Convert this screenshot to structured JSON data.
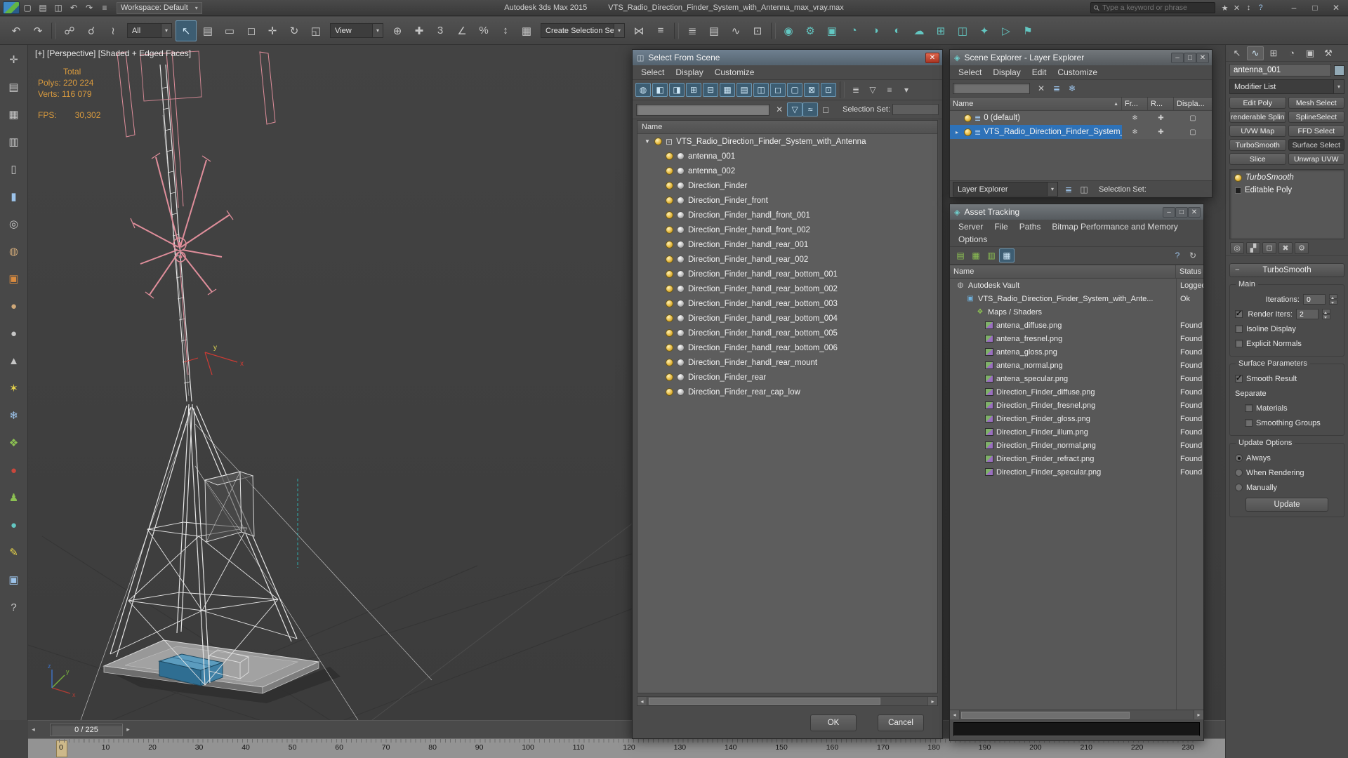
{
  "ui": {
    "caret": "▾"
  },
  "titlebar": {
    "quick_icons": [
      {
        "n": "new-scene",
        "g": "▢",
        "cls": ""
      },
      {
        "n": "open-file",
        "g": "▤",
        "cls": ""
      },
      {
        "n": "save-file",
        "g": "◫",
        "cls": ""
      },
      {
        "n": "undo",
        "g": "↶",
        "cls": ""
      },
      {
        "n": "redo",
        "g": "↷",
        "cls": ""
      },
      {
        "n": "project-folder",
        "g": "≡",
        "cls": ""
      }
    ],
    "workspace": "Workspace: Default",
    "app_title": "Autodesk 3ds Max  2015",
    "doc_title": "VTS_Radio_Direction_Finder_System_with_Antenna_max_vray.max",
    "search_placeholder": "Type a keyword or phrase",
    "search_magnifier": "⚲",
    "search_icons": [
      {
        "n": "favorites",
        "g": "★",
        "cls": ""
      },
      {
        "n": "clear-search",
        "g": "✕",
        "cls": ""
      },
      {
        "n": "search-history",
        "g": "↕",
        "cls": ""
      },
      {
        "n": "help",
        "g": "?",
        "cls": "c-blue"
      }
    ],
    "window_buttons": [
      {
        "n": "minimize",
        "g": "–"
      },
      {
        "n": "maximize",
        "g": "□"
      },
      {
        "n": "close",
        "g": "✕"
      }
    ]
  },
  "toolbar": {
    "dd_all": "All",
    "dd_view": "View",
    "dd_create": "Create Selection Se",
    "icons_a": [
      {
        "n": "undo",
        "g": "↶",
        "cls": ""
      },
      {
        "n": "redo",
        "g": "↷",
        "cls": ""
      },
      {
        "n": "sep",
        "g": "",
        "cls": "sep"
      },
      {
        "n": "select-and-link",
        "g": "☍",
        "cls": ""
      },
      {
        "n": "unlink-selection",
        "g": "☌",
        "cls": ""
      },
      {
        "n": "bind-to-space-warp",
        "g": "≀",
        "cls": ""
      }
    ],
    "icons_b": [
      {
        "n": "select-object",
        "g": "↖",
        "cls": "on"
      },
      {
        "n": "select-by-name",
        "g": "▤",
        "cls": ""
      },
      {
        "n": "rectangular-selection-region",
        "g": "▭",
        "cls": ""
      },
      {
        "n": "window-crossing",
        "g": "◻",
        "cls": ""
      }
    ],
    "icons_c": [
      {
        "n": "select-and-move",
        "g": "✛",
        "cls": ""
      },
      {
        "n": "select-and-rotate",
        "g": "↻",
        "cls": ""
      },
      {
        "n": "select-and-scale",
        "g": "◱",
        "cls": ""
      }
    ],
    "icons_d": [
      {
        "n": "use-center",
        "g": "⊕",
        "cls": ""
      },
      {
        "n": "select-and-manipulate",
        "g": "✚",
        "cls": ""
      }
    ],
    "icons_e": [
      {
        "n": "snaps-toggle",
        "g": "3",
        "cls": ""
      },
      {
        "n": "angle-snap",
        "g": "∠",
        "cls": ""
      },
      {
        "n": "percent-snap",
        "g": "%",
        "cls": ""
      },
      {
        "n": "spinner-snap",
        "g": "↕",
        "cls": ""
      }
    ],
    "icons_f": [
      {
        "n": "edit-named-selection-sets",
        "g": "▦",
        "cls": ""
      }
    ],
    "icons_g": [
      {
        "n": "mirror",
        "g": "⋈",
        "cls": ""
      },
      {
        "n": "align",
        "g": "≡",
        "cls": ""
      },
      {
        "n": "sep",
        "g": "",
        "cls": "sep"
      },
      {
        "n": "layer-manager",
        "g": "≣",
        "cls": ""
      },
      {
        "n": "graphite-ribbon",
        "g": "▤",
        "cls": ""
      },
      {
        "n": "curve-editor",
        "g": "∿",
        "cls": ""
      },
      {
        "n": "schematic-view",
        "g": "⊡",
        "cls": ""
      },
      {
        "n": "sep2",
        "g": "",
        "cls": "sep"
      }
    ],
    "icons_h": [
      {
        "n": "material-editor",
        "g": "◉",
        "cls": "c-teal"
      },
      {
        "n": "render-setup",
        "g": "⚙",
        "cls": "c-teal"
      },
      {
        "n": "rendered-frame-window",
        "g": "▣",
        "cls": "c-teal"
      },
      {
        "n": "render-production",
        "g": "◔",
        "cls": "c-teal"
      },
      {
        "n": "render-iterative",
        "g": "◑",
        "cls": "c-teal"
      },
      {
        "n": "activeshade",
        "g": "◐",
        "cls": "c-teal"
      },
      {
        "n": "a360-render",
        "g": "☁",
        "cls": "c-teal"
      },
      {
        "n": "render-elements",
        "g": "⊞",
        "cls": "c-teal"
      },
      {
        "n": "environment",
        "g": "◫",
        "cls": "c-teal"
      },
      {
        "n": "effects",
        "g": "✦",
        "cls": "c-teal"
      },
      {
        "n": "ram-player",
        "g": "▷",
        "cls": "c-teal"
      },
      {
        "n": "preview-grab",
        "g": "⚑",
        "cls": "c-teal"
      }
    ]
  },
  "left_toolbar": {
    "icons": [
      {
        "n": "pan-tool",
        "g": "✛",
        "cls": ""
      },
      {
        "n": "grid-tool",
        "g": "▤",
        "cls": ""
      },
      {
        "n": "lattice-tool",
        "g": "▦",
        "cls": ""
      },
      {
        "n": "film-tool",
        "g": "▥",
        "cls": ""
      },
      {
        "n": "cylinder-tool",
        "g": "▯",
        "cls": ""
      },
      {
        "n": "spray-tool",
        "g": "▮",
        "cls": "c-blue"
      },
      {
        "n": "wheel-tool",
        "g": "◎",
        "cls": ""
      },
      {
        "n": "teapot-tool",
        "g": "◍",
        "cls": "c-tan"
      },
      {
        "n": "box-tool",
        "g": "▣",
        "cls": "c-orange"
      },
      {
        "n": "sphere-tool",
        "g": "●",
        "cls": "c-tan"
      },
      {
        "n": "geosphere-tool",
        "g": "●",
        "cls": ""
      },
      {
        "n": "cone-tool",
        "g": "▲",
        "cls": ""
      },
      {
        "n": "star-tool",
        "g": "✶",
        "cls": "c-yellow"
      },
      {
        "n": "snowflake-tool",
        "g": "❄",
        "cls": "c-blue"
      },
      {
        "n": "foliage-tool",
        "g": "❖",
        "cls": "c-green"
      },
      {
        "n": "red-ball-tool",
        "g": "●",
        "cls": "c-red"
      },
      {
        "n": "figure-tool",
        "g": "♟",
        "cls": "c-green"
      },
      {
        "n": "teal-ball-tool",
        "g": "●",
        "cls": "c-teal"
      },
      {
        "n": "pencil-tool",
        "g": "✎",
        "cls": "c-yellow"
      },
      {
        "n": "blue-box-tool",
        "g": "▣",
        "cls": "c-blue"
      },
      {
        "n": "help-tool",
        "g": "?",
        "cls": ""
      }
    ]
  },
  "viewport": {
    "label": "[+] [Perspective] [Shaded + Edged Faces]",
    "stats": {
      "total_label": "Total",
      "polys": "Polys: 220 224",
      "verts": "Verts: 116 079",
      "fps_label": "FPS:",
      "fps_value": "30,302"
    },
    "axis": {
      "x": "x",
      "y": "y",
      "z": "z"
    }
  },
  "select_from_scene": {
    "title": "Select From Scene",
    "title_icon": "◫",
    "close_glyph": "✕",
    "menus": [
      "Select",
      "Display",
      "Customize"
    ],
    "toolbar_icons": [
      {
        "n": "display-none",
        "g": "◍",
        "cls": "on"
      },
      {
        "n": "display-geometry",
        "g": "◧",
        "cls": "on"
      },
      {
        "n": "display-shapes",
        "g": "◨",
        "cls": "on"
      },
      {
        "n": "display-lights",
        "g": "⊞",
        "cls": "on"
      },
      {
        "n": "display-cameras",
        "g": "⊟",
        "cls": "on"
      },
      {
        "n": "display-helpers",
        "g": "▦",
        "cls": "on"
      },
      {
        "n": "display-space-warps",
        "g": "▤",
        "cls": "on"
      },
      {
        "n": "display-groups",
        "g": "◫",
        "cls": "on"
      },
      {
        "n": "display-xrefs",
        "g": "◻",
        "cls": "on"
      },
      {
        "n": "display-bones",
        "g": "▢",
        "cls": "on"
      },
      {
        "n": "display-containers",
        "g": "⊠",
        "cls": "on"
      },
      {
        "n": "display-frozen",
        "g": "⊡",
        "cls": "on"
      },
      {
        "n": "sep",
        "g": "",
        "cls": "sep"
      },
      {
        "n": "sort",
        "g": "≣",
        "cls": ""
      },
      {
        "n": "filter",
        "g": "▽",
        "cls": ""
      },
      {
        "n": "column-chooser",
        "g": "≡",
        "cls": ""
      },
      {
        "n": "options",
        "g": "▾",
        "cls": ""
      }
    ],
    "filter_icons": [
      {
        "n": "clear-filter",
        "g": "✕",
        "cls": ""
      },
      {
        "n": "filter-combinations",
        "g": "▽",
        "cls": "onb"
      },
      {
        "n": "advanced-filter",
        "g": "≈",
        "cls": "onb"
      },
      {
        "n": "pick-filter",
        "g": "◻",
        "cls": ""
      }
    ],
    "selection_set_label": "Selection Set:",
    "name_header": "Name",
    "root_arrow": "▼",
    "root_icon": "⊡",
    "root": "VTS_Radio_Direction_Finder_System_with_Antenna",
    "items": [
      "antenna_001",
      "antenna_002",
      "Direction_Finder",
      "Direction_Finder_front",
      "Direction_Finder_handl_front_001",
      "Direction_Finder_handl_front_002",
      "Direction_Finder_handl_rear_001",
      "Direction_Finder_handl_rear_002",
      "Direction_Finder_handl_rear_bottom_001",
      "Direction_Finder_handl_rear_bottom_002",
      "Direction_Finder_handl_rear_bottom_003",
      "Direction_Finder_handl_rear_bottom_004",
      "Direction_Finder_handl_rear_bottom_005",
      "Direction_Finder_handl_rear_bottom_006",
      "Direction_Finder_handl_rear_mount",
      "Direction_Finder_rear",
      "Direction_Finder_rear_cap_low"
    ],
    "ok": "OK",
    "cancel": "Cancel"
  },
  "scene_explorer": {
    "title": "Scene Explorer - Layer Explorer",
    "title_icon": "◈",
    "menus": [
      "Select",
      "Display",
      "Edit",
      "Customize"
    ],
    "toolbar_icons": [
      {
        "n": "clear-search",
        "g": "✕",
        "cls": ""
      },
      {
        "n": "layer-list",
        "g": "≣",
        "cls": "c-blue"
      },
      {
        "n": "frozen-filter",
        "g": "❄",
        "cls": "c-blue"
      }
    ],
    "columns": [
      {
        "label": "Name",
        "arrow": "▲",
        "cls": "cname"
      },
      {
        "label": "Fr...",
        "arrow": "",
        "cls": "csm"
      },
      {
        "label": "R...",
        "arrow": "",
        "cls": "csm"
      },
      {
        "label": "Displa...",
        "arrow": "",
        "cls": "clg"
      }
    ],
    "layer_icon": "≣",
    "row_icons": [
      "❄",
      "✚",
      "▢"
    ],
    "rows": [
      {
        "arrow": "",
        "label": "0 (default)",
        "cls": ""
      },
      {
        "arrow": "▸",
        "label": "VTS_Radio_Direction_Finder_System_...",
        "cls": "sel"
      }
    ],
    "bottom_dropdown": "Layer Explorer",
    "bottom_icons": [
      {
        "n": "new-layer",
        "g": "≣",
        "cls": "c-blue"
      },
      {
        "n": "pick-layer",
        "g": "◫",
        "cls": ""
      }
    ],
    "selection_set_label": "Selection Set:"
  },
  "asset_tracking": {
    "title": "Asset Tracking",
    "title_icon": "◈",
    "menus": [
      "Server",
      "File",
      "Paths",
      "Bitmap Performance and Memory",
      "Options"
    ],
    "toolbar_left": [
      {
        "n": "status-view",
        "g": "▤",
        "cls": "c-green"
      },
      {
        "n": "detail-view",
        "g": "▦",
        "cls": "c-green"
      },
      {
        "n": "list-view",
        "g": "▥",
        "cls": "c-green"
      },
      {
        "n": "table-view",
        "g": "▦",
        "cls": "on"
      }
    ],
    "toolbar_right": [
      {
        "n": "help",
        "g": "?",
        "cls": "c-blue"
      },
      {
        "n": "refresh",
        "g": "↻",
        "cls": ""
      }
    ],
    "name_header": "Name",
    "status_header": "Status",
    "rows": [
      {
        "name": "Autodesk Vault",
        "status": "Logged",
        "icon": "i-vault",
        "g": "◍",
        "ind": "ind1"
      },
      {
        "name": "VTS_Radio_Direction_Finder_System_with_Ante...",
        "status": "Ok",
        "icon": "i-scene",
        "g": "▣",
        "ind": "ind2"
      },
      {
        "name": "Maps / Shaders",
        "status": "",
        "icon": "i-maps",
        "g": "❖",
        "ind": "ind3"
      },
      {
        "name": "antena_diffuse.png",
        "status": "Found",
        "icon": "i-png",
        "g": "",
        "ind": "ind4"
      },
      {
        "name": "antena_fresnel.png",
        "status": "Found",
        "icon": "i-png",
        "g": "",
        "ind": "ind4"
      },
      {
        "name": "antena_gloss.png",
        "status": "Found",
        "icon": "i-png",
        "g": "",
        "ind": "ind4"
      },
      {
        "name": "antena_normal.png",
        "status": "Found",
        "icon": "i-png",
        "g": "",
        "ind": "ind4"
      },
      {
        "name": "antena_specular.png",
        "status": "Found",
        "icon": "i-png",
        "g": "",
        "ind": "ind4"
      },
      {
        "name": "Direction_Finder_diffuse.png",
        "status": "Found",
        "icon": "i-png",
        "g": "",
        "ind": "ind4"
      },
      {
        "name": "Direction_Finder_fresnel.png",
        "status": "Found",
        "icon": "i-png",
        "g": "",
        "ind": "ind4"
      },
      {
        "name": "Direction_Finder_gloss.png",
        "status": "Found",
        "icon": "i-png",
        "g": "",
        "ind": "ind4"
      },
      {
        "name": "Direction_Finder_illum.png",
        "status": "Found",
        "icon": "i-png",
        "g": "",
        "ind": "ind4"
      },
      {
        "name": "Direction_Finder_normal.png",
        "status": "Found",
        "icon": "i-png",
        "g": "",
        "ind": "ind4"
      },
      {
        "name": "Direction_Finder_refract.png",
        "status": "Found",
        "icon": "i-png",
        "g": "",
        "ind": "ind4"
      },
      {
        "name": "Direction_Finder_specular.png",
        "status": "Found",
        "icon": "i-png",
        "g": "",
        "ind": "ind4"
      }
    ]
  },
  "command_panel": {
    "tabs": [
      {
        "n": "tab-create",
        "g": "↖",
        "cls": ""
      },
      {
        "n": "tab-modify",
        "g": "∿",
        "cls": "on"
      },
      {
        "n": "tab-hierarchy",
        "g": "⊞",
        "cls": ""
      },
      {
        "n": "tab-motion",
        "g": "◔",
        "cls": ""
      },
      {
        "n": "tab-display",
        "g": "▣",
        "cls": ""
      },
      {
        "n": "tab-utilities",
        "g": "⚒",
        "cls": ""
      }
    ],
    "object_name": "antenna_001",
    "modifier_list_label": "Modifier List",
    "modifier_buttons": [
      {
        "label": "Edit Poly",
        "cls": ""
      },
      {
        "label": "Mesh Select",
        "cls": ""
      },
      {
        "label": "renderable Splin",
        "cls": ""
      },
      {
        "label": "SplineSelect",
        "cls": ""
      },
      {
        "label": "UVW Map",
        "cls": ""
      },
      {
        "label": "FFD Select",
        "cls": ""
      },
      {
        "label": "TurboSmooth",
        "cls": ""
      },
      {
        "label": "Surface Select",
        "cls": "dark"
      },
      {
        "label": "Slice",
        "cls": ""
      },
      {
        "label": "Unwrap UVW",
        "cls": ""
      }
    ],
    "stack": [
      {
        "label": "TurboSmooth",
        "cls": "italic",
        "icon": "i-bulb"
      },
      {
        "label": "Editable Poly",
        "cls": "",
        "icon": "i-poly"
      }
    ],
    "stack_tools": [
      {
        "n": "pin-stack",
        "g": "◎"
      },
      {
        "n": "show-end-result",
        "g": "▞"
      },
      {
        "n": "make-unique",
        "g": "⊡"
      },
      {
        "n": "remove-modifier",
        "g": "✖"
      },
      {
        "n": "configure-modifier-sets",
        "g": "⚙"
      }
    ],
    "rollout_title": "TurboSmooth",
    "main_group": {
      "title": "Main",
      "iterations_label": "Iterations:",
      "iterations_value": "0",
      "render_iters_label": "Render Iters:",
      "render_iters_value": "2",
      "isoline_label": "Isoline Display",
      "explicit_label": "Explicit Normals"
    },
    "checks": {
      "render_iters": true,
      "isoline": false,
      "explicit": false,
      "smooth_result": true,
      "materials": false,
      "smoothing_groups": false
    },
    "surface_group": {
      "title": "Surface Parameters",
      "smooth_label": "Smooth Result",
      "separate_label": "Separate",
      "materials_label": "Materials",
      "smoothing_label": "Smoothing Groups"
    },
    "update_group": {
      "title": "Update Options",
      "options": [
        {
          "label": "Always",
          "cls": "on"
        },
        {
          "label": "When Rendering",
          "cls": ""
        },
        {
          "label": "Manually",
          "cls": ""
        }
      ],
      "button": "Update"
    }
  },
  "timeline": {
    "current": "0 / 225",
    "prev": "◂",
    "next": "▸",
    "ticks": [
      "0",
      "10",
      "20",
      "30",
      "40",
      "50",
      "60",
      "70",
      "80",
      "90",
      "100",
      "110",
      "120",
      "130",
      "140",
      "150",
      "160",
      "170",
      "180",
      "190",
      "200",
      "210",
      "220",
      "230"
    ]
  }
}
